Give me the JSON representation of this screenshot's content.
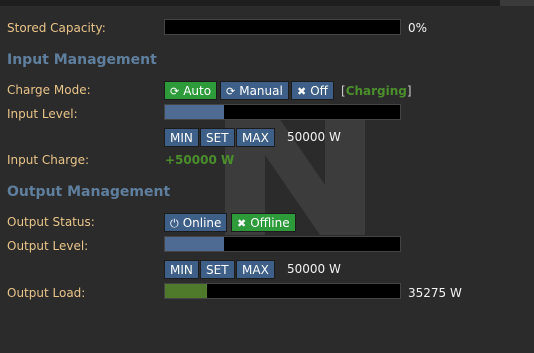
{
  "stored": {
    "label": "Stored Capacity:",
    "value": "0%",
    "fill": 0
  },
  "input": {
    "heading": "Input Management",
    "charge_mode_label": "Charge Mode:",
    "buttons": {
      "auto": "Auto",
      "manual": "Manual",
      "off": "Off"
    },
    "status_open": "[",
    "status": "Charging",
    "status_close": "]",
    "level_label": "Input Level:",
    "level_fill": 0.25,
    "level_buttons": {
      "min": "MIN",
      "set": "SET",
      "max": "MAX"
    },
    "level_value": "50000 W",
    "charge_label": "Input Charge:",
    "charge_value": "+50000 W"
  },
  "output": {
    "heading": "Output Management",
    "status_label": "Output Status:",
    "buttons": {
      "online": "Online",
      "offline": "Offline"
    },
    "level_label": "Output Level:",
    "level_fill": 0.25,
    "level_buttons": {
      "min": "MIN",
      "set": "SET",
      "max": "MAX"
    },
    "level_value": "50000 W",
    "load_label": "Output Load:",
    "load_fill": 0.18,
    "load_value": "35275 W"
  },
  "colors": {
    "accent": "#e9c488",
    "blue": "#3d5f88",
    "green": "#2e9b3b",
    "heading": "#5f7f9f",
    "status_green": "#4a8f2b"
  },
  "icons": {
    "auto": "refresh-icon",
    "manual": "refresh-icon",
    "off": "close-icon",
    "online": "power-icon",
    "offline": "close-icon"
  }
}
